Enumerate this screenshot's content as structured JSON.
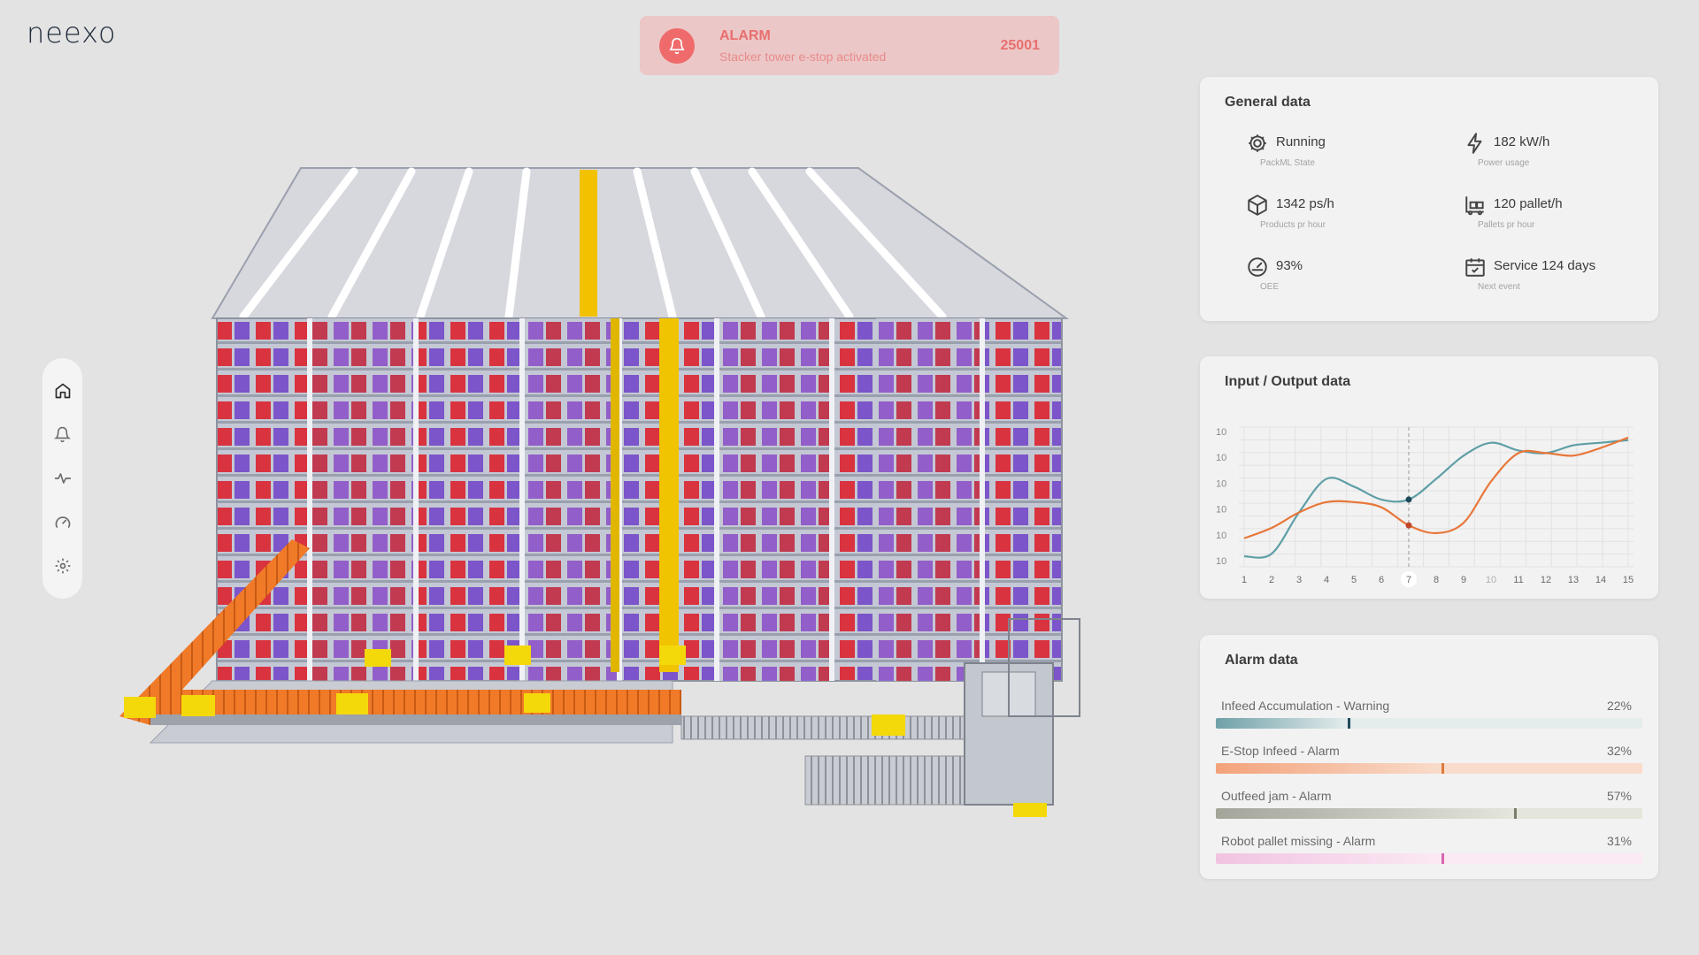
{
  "brand": {
    "logo": "neexo"
  },
  "alarm": {
    "title": "ALARM",
    "message": "Stacker tower e-stop activated",
    "code": "25001",
    "icon": "bell-icon",
    "color": "#ef6b6b"
  },
  "sidebar": {
    "items": [
      {
        "name": "home",
        "icon": "home-icon"
      },
      {
        "name": "alarms",
        "icon": "bell-icon"
      },
      {
        "name": "activity",
        "icon": "activity-icon"
      },
      {
        "name": "performance",
        "icon": "gauge-icon"
      },
      {
        "name": "settings",
        "icon": "gear-icon"
      }
    ]
  },
  "general": {
    "title": "General data",
    "items": [
      {
        "value": "Running",
        "label": "PackML State",
        "icon": "gear-icon"
      },
      {
        "value": "182 kW/h",
        "label": "Power usage",
        "icon": "lightning-icon"
      },
      {
        "value": "1342 ps/h",
        "label": "Products pr hour",
        "icon": "box-icon"
      },
      {
        "value": "120 pallet/h",
        "label": "Pallets pr hour",
        "icon": "forklift-icon"
      },
      {
        "value": "93%",
        "label": "OEE",
        "icon": "gauge-icon"
      },
      {
        "value": "Service 124 days",
        "label": "Next event",
        "icon": "calendar-icon"
      }
    ]
  },
  "io": {
    "title": "Input / Output data",
    "chart_data": {
      "type": "line",
      "x": [
        1,
        2,
        3,
        4,
        5,
        6,
        7,
        8,
        9,
        10,
        11,
        12,
        13,
        14,
        15
      ],
      "tick_labels_y": [
        "10",
        "10",
        "10",
        "10",
        "10",
        "10"
      ],
      "tick_labels_x": [
        "1",
        "2",
        "3",
        "4",
        "5",
        "6",
        "7",
        "8",
        "9",
        "10",
        "11",
        "12",
        "13",
        "14",
        "15"
      ],
      "highlight_x": 7,
      "ylim": [
        0,
        5
      ],
      "series": [
        {
          "color": "#5e9fa6",
          "values": [
            0.2,
            0.3,
            1.9,
            3.2,
            2.9,
            2.4,
            2.4,
            3.2,
            4.1,
            4.6,
            4.3,
            4.2,
            4.5,
            4.6,
            4.7
          ]
        },
        {
          "color": "#e8773a",
          "values": [
            0.9,
            1.3,
            1.9,
            2.3,
            2.3,
            2.1,
            1.4,
            1.1,
            1.5,
            3.1,
            4.2,
            4.2,
            4.1,
            4.4,
            4.8
          ]
        }
      ],
      "grid": true
    }
  },
  "alarms": {
    "title": "Alarm data",
    "items": [
      {
        "label": "Infeed Accumulation - Warning",
        "pct": "22%",
        "value": 0.31,
        "fill": "#6fa1a8",
        "track": "#e4ecec",
        "marker": "#1f4a5a"
      },
      {
        "label": "E-Stop Infeed - Alarm",
        "pct": "32%",
        "value": 0.53,
        "fill": "#f3a27a",
        "track": "#f9dccb",
        "marker": "#e07a3e"
      },
      {
        "label": "Outfeed jam - Alarm",
        "pct": "57%",
        "value": 0.7,
        "fill": "#a3a59a",
        "track": "#e4e6dc",
        "marker": "#7a7d6a"
      },
      {
        "label": "Robot pallet missing - Alarm",
        "pct": "31%",
        "value": 0.53,
        "fill": "#f1c4e2",
        "track": "#fbe9f3",
        "marker": "#d766b0"
      }
    ]
  }
}
